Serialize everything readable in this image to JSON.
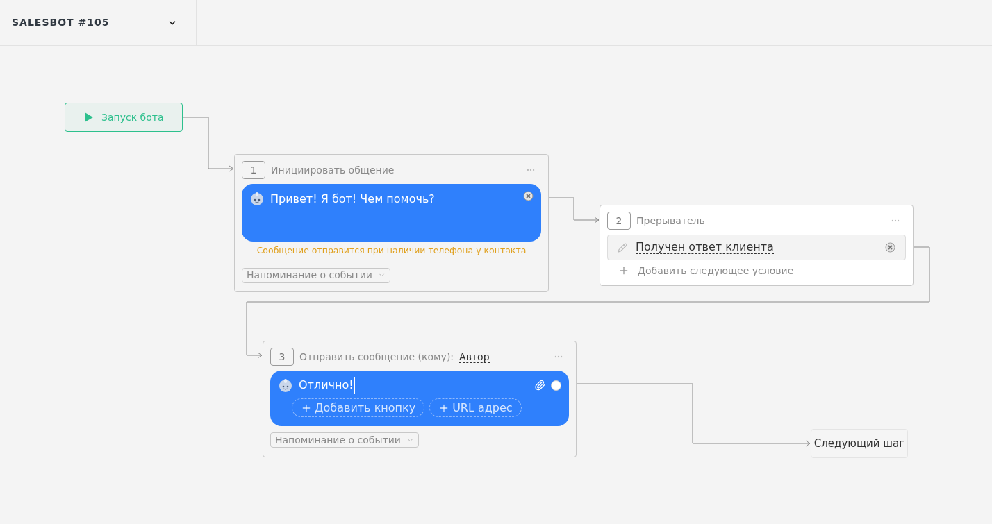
{
  "header": {
    "title": "SALESBOT #105"
  },
  "start_node": {
    "label": "Запуск бота"
  },
  "steps": [
    {
      "kind": "message",
      "number": "1",
      "title": "Инициировать общение",
      "message": "Привет! Я бот! Чем помочь?",
      "warning": "Сообщение отправится при наличии телефона у контакта",
      "reminder": "Напоминание о событии"
    },
    {
      "kind": "condition",
      "number": "2",
      "title": "Прерыватель",
      "condition": "Получен ответ клиента",
      "add_condition": "Добавить следующее условие"
    },
    {
      "kind": "send",
      "number": "3",
      "title": "Отправить сообщение (кому):",
      "recipient": "Автор",
      "message": "Отлично!",
      "buttons": [
        "Добавить кнопку",
        "URL адрес"
      ],
      "reminder": "Напоминание о событии"
    }
  ],
  "next_step": {
    "label": "Следующий шаг"
  }
}
